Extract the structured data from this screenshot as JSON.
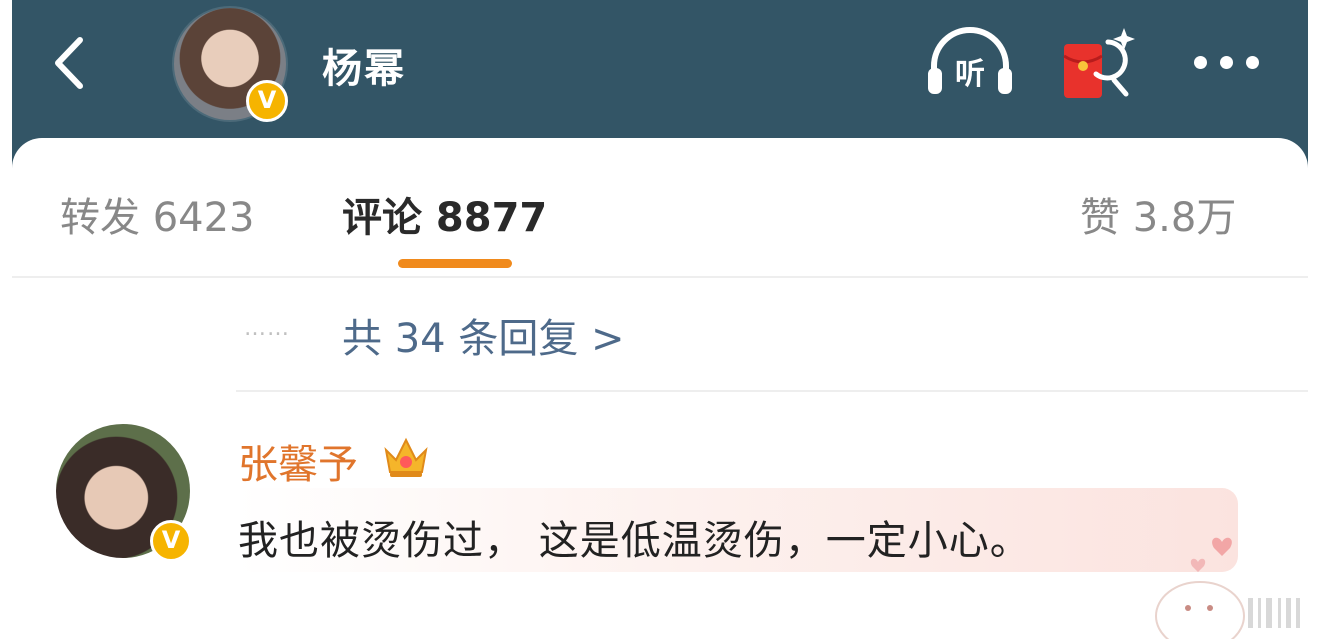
{
  "header": {
    "title": "杨幂",
    "listen_label": "听",
    "verified_mark": "V",
    "icons": [
      "back-arrow-icon",
      "headphones-icon",
      "red-packet-icon",
      "more-icon"
    ],
    "bg_color": "#335566"
  },
  "tabs": [
    {
      "label": "转发 6423",
      "active": false
    },
    {
      "label": "评论 8877",
      "active": true
    },
    {
      "label": "赞 3.8万",
      "active": false
    }
  ],
  "thread": {
    "ellipsis": "……",
    "more_replies": "共 34 条回复 >"
  },
  "comment": {
    "author": "张馨予",
    "verified_mark": "V",
    "text": "我也被烫伤过， 这是低温烫伤，一定小心。",
    "author_color": "#e0752c"
  },
  "colors": {
    "accent": "#f08a1c",
    "link": "#4e6a8a"
  }
}
